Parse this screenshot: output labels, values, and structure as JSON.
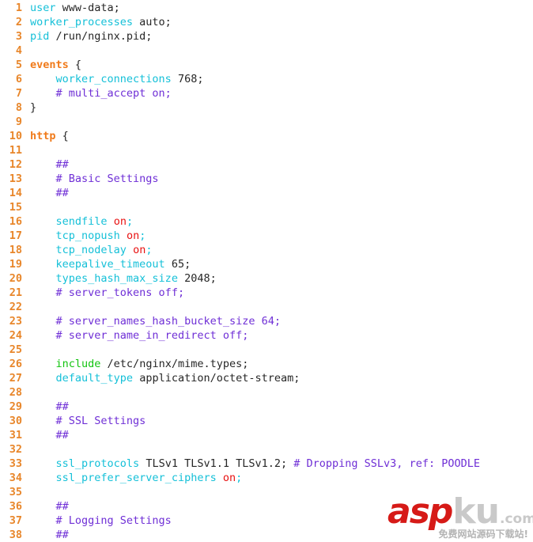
{
  "file": {
    "name": "nginx.conf",
    "language": "nginx"
  },
  "editor": {
    "background": "#ffffff",
    "gutter_color": "#e8862a",
    "first_visible_line": 1,
    "last_visible_line": 38,
    "indent": "    "
  },
  "colors": {
    "line_number": "#e8862a",
    "directive": "#15c0d8",
    "block_keyword": "#f07a1a",
    "include_keyword": "#12c40f",
    "comment": "#6f2fd6",
    "boolean_value": "#e81111",
    "plain_text": "#262626",
    "punctuation": "#15c0d8",
    "watermark_red": "#d61a17",
    "watermark_grey": "#c9c9c9"
  },
  "lines": [
    {
      "n": 1,
      "tokens": [
        {
          "t": "user",
          "c": "directive"
        },
        {
          "t": " www-data;",
          "c": "plain"
        }
      ]
    },
    {
      "n": 2,
      "tokens": [
        {
          "t": "worker_processes",
          "c": "directive"
        },
        {
          "t": " auto;",
          "c": "plain"
        }
      ]
    },
    {
      "n": 3,
      "tokens": [
        {
          "t": "pid",
          "c": "directive"
        },
        {
          "t": " /run/nginx.pid;",
          "c": "plain"
        }
      ]
    },
    {
      "n": 4,
      "tokens": []
    },
    {
      "n": 5,
      "tokens": [
        {
          "t": "events",
          "c": "block"
        },
        {
          "t": " {",
          "c": "plain"
        }
      ]
    },
    {
      "n": 6,
      "tokens": [
        {
          "t": "    ",
          "c": "plain"
        },
        {
          "t": "worker_connections",
          "c": "directive"
        },
        {
          "t": " 768;",
          "c": "plain"
        }
      ]
    },
    {
      "n": 7,
      "tokens": [
        {
          "t": "    ",
          "c": "plain"
        },
        {
          "t": "# multi_accept on;",
          "c": "comment"
        }
      ]
    },
    {
      "n": 8,
      "tokens": [
        {
          "t": "}",
          "c": "plain"
        }
      ]
    },
    {
      "n": 9,
      "tokens": []
    },
    {
      "n": 10,
      "tokens": [
        {
          "t": "http",
          "c": "block"
        },
        {
          "t": " {",
          "c": "plain"
        }
      ]
    },
    {
      "n": 11,
      "tokens": []
    },
    {
      "n": 12,
      "tokens": [
        {
          "t": "    ",
          "c": "plain"
        },
        {
          "t": "##",
          "c": "comment"
        }
      ]
    },
    {
      "n": 13,
      "tokens": [
        {
          "t": "    ",
          "c": "plain"
        },
        {
          "t": "# Basic Settings",
          "c": "comment"
        }
      ]
    },
    {
      "n": 14,
      "tokens": [
        {
          "t": "    ",
          "c": "plain"
        },
        {
          "t": "##",
          "c": "comment"
        }
      ]
    },
    {
      "n": 15,
      "tokens": []
    },
    {
      "n": 16,
      "tokens": [
        {
          "t": "    ",
          "c": "plain"
        },
        {
          "t": "sendfile",
          "c": "directive"
        },
        {
          "t": " ",
          "c": "plain"
        },
        {
          "t": "on",
          "c": "bool"
        },
        {
          "t": ";",
          "c": "punct"
        }
      ]
    },
    {
      "n": 17,
      "tokens": [
        {
          "t": "    ",
          "c": "plain"
        },
        {
          "t": "tcp_nopush",
          "c": "directive"
        },
        {
          "t": " ",
          "c": "plain"
        },
        {
          "t": "on",
          "c": "bool"
        },
        {
          "t": ";",
          "c": "punct"
        }
      ]
    },
    {
      "n": 18,
      "tokens": [
        {
          "t": "    ",
          "c": "plain"
        },
        {
          "t": "tcp_nodelay",
          "c": "directive"
        },
        {
          "t": " ",
          "c": "plain"
        },
        {
          "t": "on",
          "c": "bool"
        },
        {
          "t": ";",
          "c": "punct"
        }
      ]
    },
    {
      "n": 19,
      "tokens": [
        {
          "t": "    ",
          "c": "plain"
        },
        {
          "t": "keepalive_timeout",
          "c": "directive"
        },
        {
          "t": " 65;",
          "c": "plain"
        }
      ]
    },
    {
      "n": 20,
      "tokens": [
        {
          "t": "    ",
          "c": "plain"
        },
        {
          "t": "types_hash_max_size",
          "c": "directive"
        },
        {
          "t": " 2048;",
          "c": "plain"
        }
      ]
    },
    {
      "n": 21,
      "tokens": [
        {
          "t": "    ",
          "c": "plain"
        },
        {
          "t": "# server_tokens off;",
          "c": "comment"
        }
      ]
    },
    {
      "n": 22,
      "tokens": []
    },
    {
      "n": 23,
      "tokens": [
        {
          "t": "    ",
          "c": "plain"
        },
        {
          "t": "# server_names_hash_bucket_size 64;",
          "c": "comment"
        }
      ]
    },
    {
      "n": 24,
      "tokens": [
        {
          "t": "    ",
          "c": "plain"
        },
        {
          "t": "# server_name_in_redirect off;",
          "c": "comment"
        }
      ]
    },
    {
      "n": 25,
      "tokens": []
    },
    {
      "n": 26,
      "tokens": [
        {
          "t": "    ",
          "c": "plain"
        },
        {
          "t": "include",
          "c": "include"
        },
        {
          "t": " /etc/nginx/mime.types;",
          "c": "plain"
        }
      ]
    },
    {
      "n": 27,
      "tokens": [
        {
          "t": "    ",
          "c": "plain"
        },
        {
          "t": "default_type",
          "c": "directive"
        },
        {
          "t": " application/octet-stream;",
          "c": "plain"
        }
      ]
    },
    {
      "n": 28,
      "tokens": []
    },
    {
      "n": 29,
      "tokens": [
        {
          "t": "    ",
          "c": "plain"
        },
        {
          "t": "##",
          "c": "comment"
        }
      ]
    },
    {
      "n": 30,
      "tokens": [
        {
          "t": "    ",
          "c": "plain"
        },
        {
          "t": "# SSL Settings",
          "c": "comment"
        }
      ]
    },
    {
      "n": 31,
      "tokens": [
        {
          "t": "    ",
          "c": "plain"
        },
        {
          "t": "##",
          "c": "comment"
        }
      ]
    },
    {
      "n": 32,
      "tokens": []
    },
    {
      "n": 33,
      "tokens": [
        {
          "t": "    ",
          "c": "plain"
        },
        {
          "t": "ssl_protocols",
          "c": "directive"
        },
        {
          "t": " TLSv1 TLSv1.1 TLSv1.2; ",
          "c": "plain"
        },
        {
          "t": "# Dropping SSLv3, ref: POODLE",
          "c": "comment"
        }
      ]
    },
    {
      "n": 34,
      "tokens": [
        {
          "t": "    ",
          "c": "plain"
        },
        {
          "t": "ssl_prefer_server_ciphers",
          "c": "directive"
        },
        {
          "t": " ",
          "c": "plain"
        },
        {
          "t": "on",
          "c": "bool"
        },
        {
          "t": ";",
          "c": "punct"
        }
      ]
    },
    {
      "n": 35,
      "tokens": []
    },
    {
      "n": 36,
      "tokens": [
        {
          "t": "    ",
          "c": "plain"
        },
        {
          "t": "##",
          "c": "comment"
        }
      ]
    },
    {
      "n": 37,
      "tokens": [
        {
          "t": "    ",
          "c": "plain"
        },
        {
          "t": "# Logging Settings",
          "c": "comment"
        }
      ]
    },
    {
      "n": 38,
      "tokens": [
        {
          "t": "    ",
          "c": "plain"
        },
        {
          "t": "##",
          "c": "comment"
        }
      ]
    }
  ],
  "watermark": {
    "part_red": "asp",
    "part_grey": "ku",
    "domain_suffix": ".com",
    "tagline": "免费网站源码下载站!"
  }
}
